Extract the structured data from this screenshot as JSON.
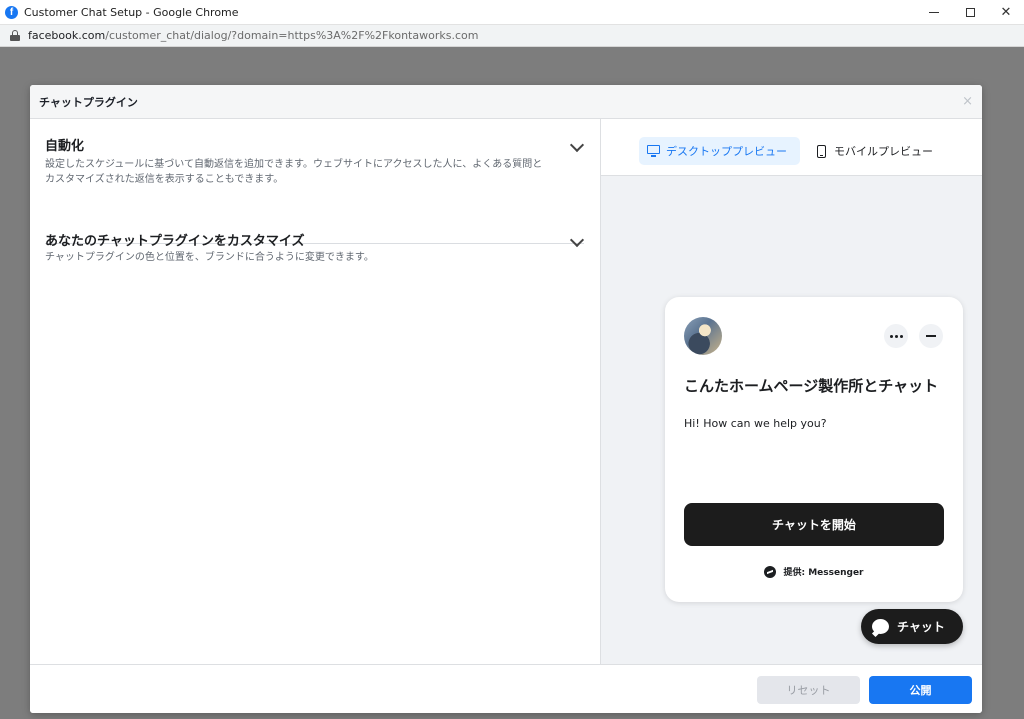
{
  "window": {
    "title": "Customer Chat Setup - Google Chrome",
    "logo_letter": "f"
  },
  "urlbar": {
    "host": "facebook.com",
    "path": "/customer_chat/dialog/?domain=https%3A%2F%2Fkontaworks.com"
  },
  "dialog": {
    "title": "チャットプラグイン",
    "close": "×",
    "sections": [
      {
        "title": "自動化",
        "description": "設定したスケジュールに基づいて自動返信を追加できます。ウェブサイトにアクセスした人に、よくある質問とカスタマイズされた返信を表示することもできます。"
      },
      {
        "title": "あなたのチャットプラグインをカスタマイズ",
        "description": "チャットプラグインの色と位置を、ブランドに合うように変更できます。"
      }
    ],
    "preview_tabs": {
      "desktop": "デスクトッププレビュー",
      "mobile": "モバイルプレビュー"
    },
    "chat_preview": {
      "page_name": "こんたホームページ製作所とチャット",
      "greeting": "Hi! How can we help you?",
      "start_button": "チャットを開始",
      "powered_by": "提供: Messenger",
      "fab_label": "チャット"
    },
    "footer": {
      "reset": "リセット",
      "publish": "公開"
    }
  },
  "colors": {
    "accent": "#1877f2",
    "dark_button": "#1c1c1c",
    "preview_bg": "#f0f2f5"
  }
}
